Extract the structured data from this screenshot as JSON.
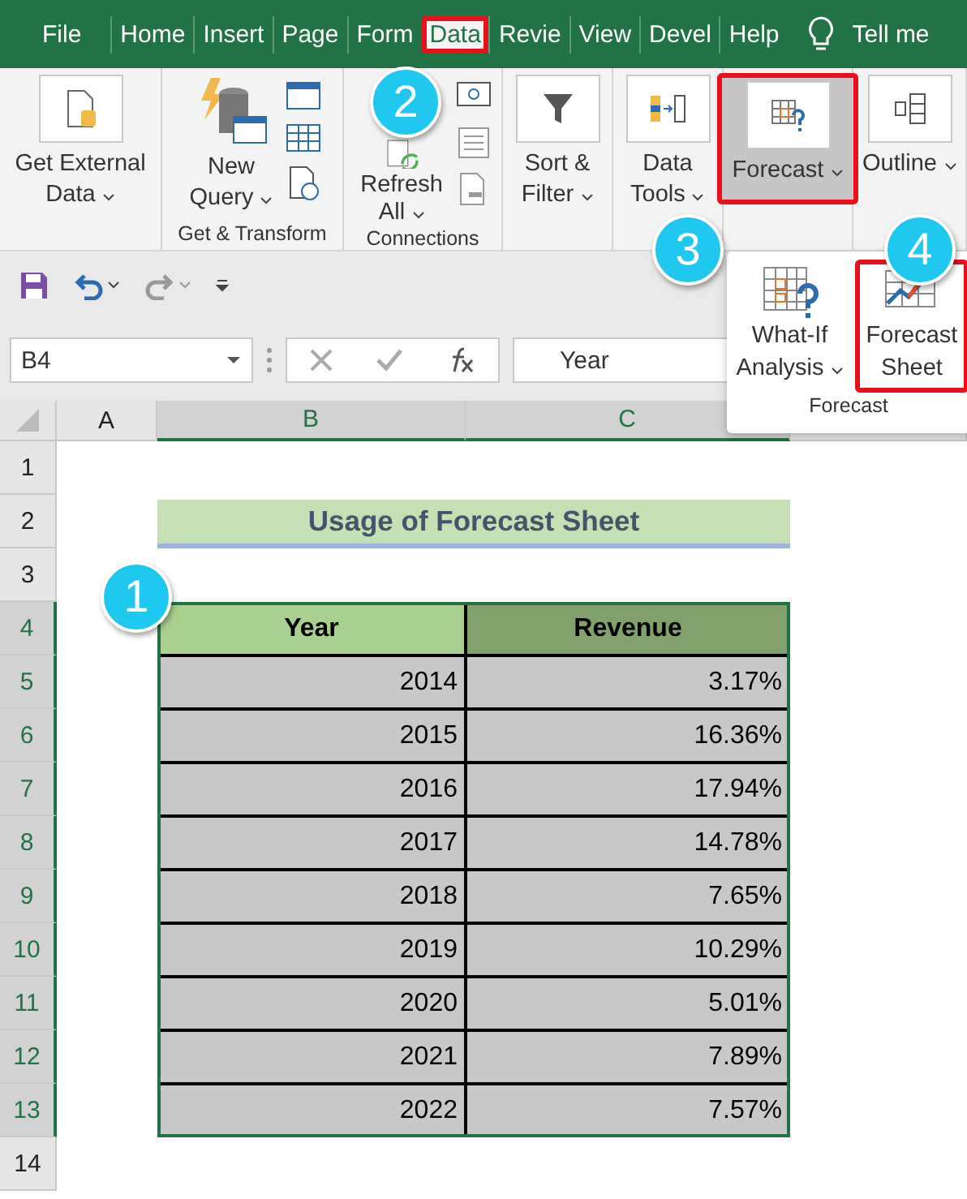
{
  "tabs": [
    {
      "label": "File",
      "selected": false,
      "highlighted": false
    },
    {
      "label": "Home",
      "selected": false,
      "highlighted": false
    },
    {
      "label": "Insert",
      "selected": false,
      "highlighted": false
    },
    {
      "label": "Page",
      "selected": false,
      "highlighted": false
    },
    {
      "label": "Form",
      "selected": false,
      "highlighted": false
    },
    {
      "label": "Data",
      "selected": true,
      "highlighted": true
    },
    {
      "label": "Revie",
      "selected": false,
      "highlighted": false
    },
    {
      "label": "View",
      "selected": false,
      "highlighted": false
    },
    {
      "label": "Devel",
      "selected": false,
      "highlighted": false
    },
    {
      "label": "Help",
      "selected": false,
      "highlighted": false
    }
  ],
  "tell_me": "Tell me",
  "ribbon": [
    {
      "commands": [
        {
          "label": [
            "Get External",
            "Data"
          ],
          "dropdown": true,
          "highlighted": false
        }
      ]
    },
    {
      "label": "Get & Transform",
      "commands": [
        {
          "label": [
            "New",
            "Query"
          ],
          "dropdown": true,
          "highlighted": false
        }
      ]
    },
    {
      "label": "Connections",
      "commands": [
        {
          "label": [
            "Refresh",
            "All"
          ],
          "dropdown": true,
          "highlighted": false
        }
      ]
    },
    {
      "commands": [
        {
          "label": [
            "Sort &",
            "Filter"
          ],
          "dropdown": true,
          "highlighted": false
        }
      ]
    },
    {
      "commands": [
        {
          "label": [
            "Data",
            "Tools"
          ],
          "dropdown": true,
          "highlighted": false
        }
      ]
    },
    {
      "commands": [
        {
          "label": [
            "Forecast"
          ],
          "dropdown": true,
          "highlighted": true
        }
      ]
    },
    {
      "commands": [
        {
          "label": [
            "Outline"
          ],
          "dropdown": true,
          "highlighted": false
        }
      ]
    }
  ],
  "forecast_menu": {
    "label": "Forecast",
    "commands": [
      {
        "label": [
          "What-If",
          "Analysis"
        ],
        "dropdown": true,
        "highlighted": false
      },
      {
        "label": [
          "Forecast",
          "Sheet"
        ],
        "dropdown": false,
        "highlighted": true
      }
    ]
  },
  "name_box": "B4",
  "formula": "Year",
  "columns": [
    {
      "label": "A",
      "selected": false
    },
    {
      "label": "B",
      "selected": true
    },
    {
      "label": "C",
      "selected": true
    }
  ],
  "rows": [
    {
      "label": "1",
      "selected": false
    },
    {
      "label": "2",
      "selected": false
    },
    {
      "label": "3",
      "selected": false
    },
    {
      "label": "4",
      "selected": true
    },
    {
      "label": "5",
      "selected": true
    },
    {
      "label": "6",
      "selected": true
    },
    {
      "label": "7",
      "selected": true
    },
    {
      "label": "8",
      "selected": true
    },
    {
      "label": "9",
      "selected": true
    },
    {
      "label": "10",
      "selected": true
    },
    {
      "label": "11",
      "selected": true
    },
    {
      "label": "12",
      "selected": true
    },
    {
      "label": "13",
      "selected": true
    },
    {
      "label": "14",
      "selected": false
    }
  ],
  "sheet": {
    "title": "Usage of Forecast Sheet",
    "headers": [
      "Year",
      "Revenue"
    ],
    "data": [
      [
        "2014",
        "3.17%"
      ],
      [
        "2015",
        "16.36%"
      ],
      [
        "2016",
        "17.94%"
      ],
      [
        "2017",
        "14.78%"
      ],
      [
        "2018",
        "7.65%"
      ],
      [
        "2019",
        "10.29%"
      ],
      [
        "2020",
        "5.01%"
      ],
      [
        "2021",
        "7.89%"
      ],
      [
        "2022",
        "7.57%"
      ]
    ]
  },
  "callouts": [
    "1",
    "2",
    "3",
    "4"
  ]
}
